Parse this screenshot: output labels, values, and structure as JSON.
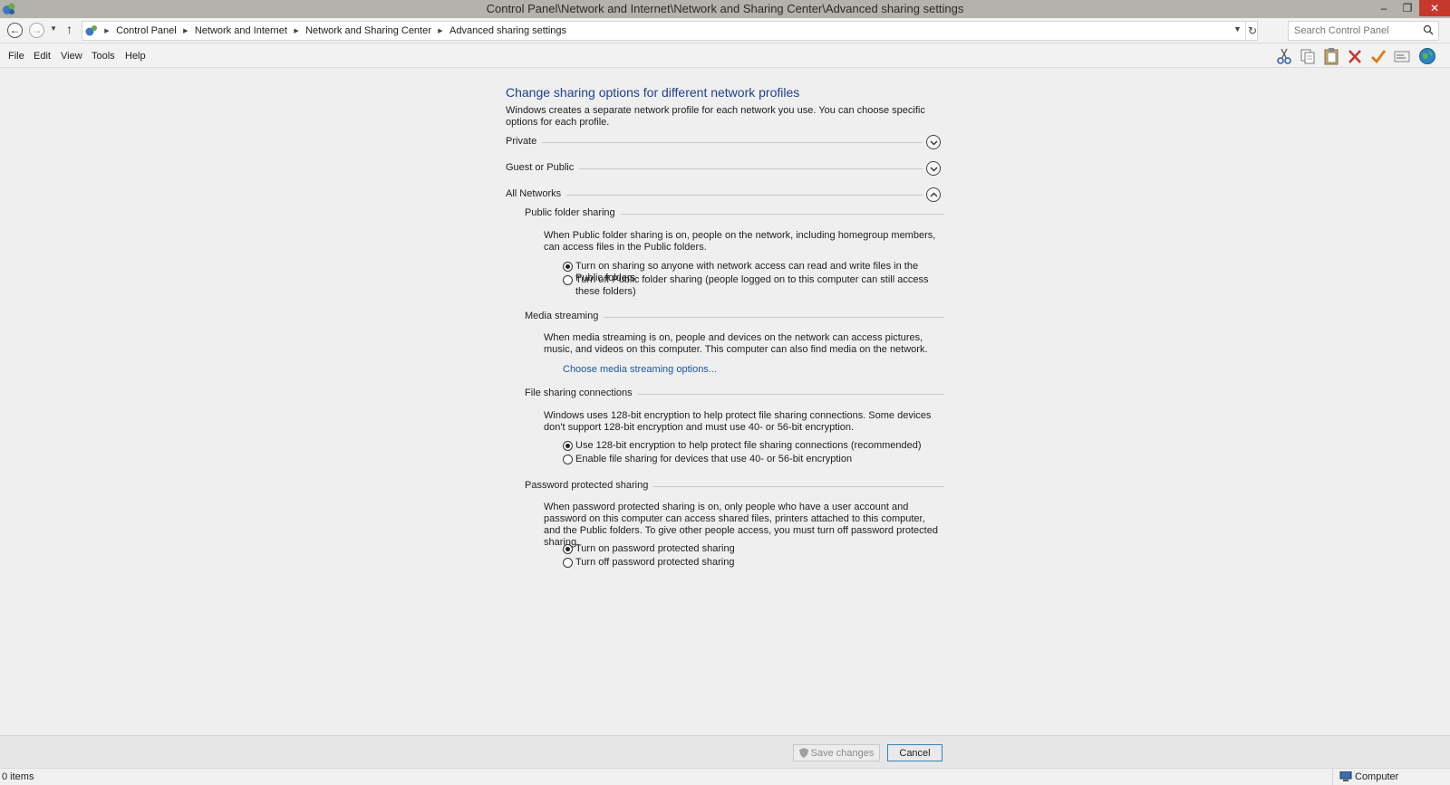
{
  "window": {
    "title": "Control Panel\\Network and Internet\\Network and Sharing Center\\Advanced sharing settings",
    "minimize_glyph": "–",
    "maximize_glyph": "❐",
    "close_glyph": "✕"
  },
  "address": {
    "crumbs": [
      "Control Panel",
      "Network and Internet",
      "Network and Sharing Center",
      "Advanced sharing settings"
    ],
    "search_placeholder": "Search Control Panel"
  },
  "menu": {
    "items": [
      "File",
      "Edit",
      "View",
      "Tools",
      "Help"
    ]
  },
  "toolbar_icons": [
    "cut-icon",
    "copy-icon",
    "paste-icon",
    "delete-icon",
    "checkmark-icon",
    "properties-icon",
    "globe-icon"
  ],
  "page": {
    "title": "Change sharing options for different network profiles",
    "intro": "Windows creates a separate network profile for each network you use. You can choose specific options for each profile.",
    "profiles": [
      {
        "label": "Private",
        "expanded": false
      },
      {
        "label": "Guest or Public",
        "expanded": false
      },
      {
        "label": "All Networks",
        "expanded": true
      }
    ],
    "public_folder": {
      "heading": "Public folder sharing",
      "description": "When Public folder sharing is on, people on the network, including homegroup members, can access files in the Public folders.",
      "options": [
        {
          "label": "Turn on sharing so anyone with network access can read and write files in the Public folders",
          "selected": true
        },
        {
          "label": "Turn off Public folder sharing (people logged on to this computer can still access these folders)",
          "selected": false
        }
      ]
    },
    "media": {
      "heading": "Media streaming",
      "description": "When media streaming is on, people and devices on the network can access pictures, music, and videos on this computer. This computer can also find media on the network.",
      "link": "Choose media streaming options..."
    },
    "file_sharing": {
      "heading": "File sharing connections",
      "description": "Windows uses 128-bit encryption to help protect file sharing connections. Some devices don't support 128-bit encryption and must use 40- or 56-bit encryption.",
      "options": [
        {
          "label": "Use 128-bit encryption to help protect file sharing connections (recommended)",
          "selected": true
        },
        {
          "label": "Enable file sharing for devices that use 40- or 56-bit encryption",
          "selected": false
        }
      ]
    },
    "password": {
      "heading": "Password protected sharing",
      "description": "When password protected sharing is on, only people who have a user account and password on this computer can access shared files, printers attached to this computer, and the Public folders. To give other people access, you must turn off password protected sharing.",
      "options": [
        {
          "label": "Turn on password protected sharing",
          "selected": true
        },
        {
          "label": "Turn off password protected sharing",
          "selected": false
        }
      ]
    }
  },
  "buttons": {
    "save": "Save changes",
    "cancel": "Cancel"
  },
  "status": {
    "items": "0 items",
    "zone": "Computer"
  },
  "colors": {
    "title_blue": "#1f3f8f",
    "link_blue": "#1a57a8",
    "close_red": "#c7382c"
  }
}
